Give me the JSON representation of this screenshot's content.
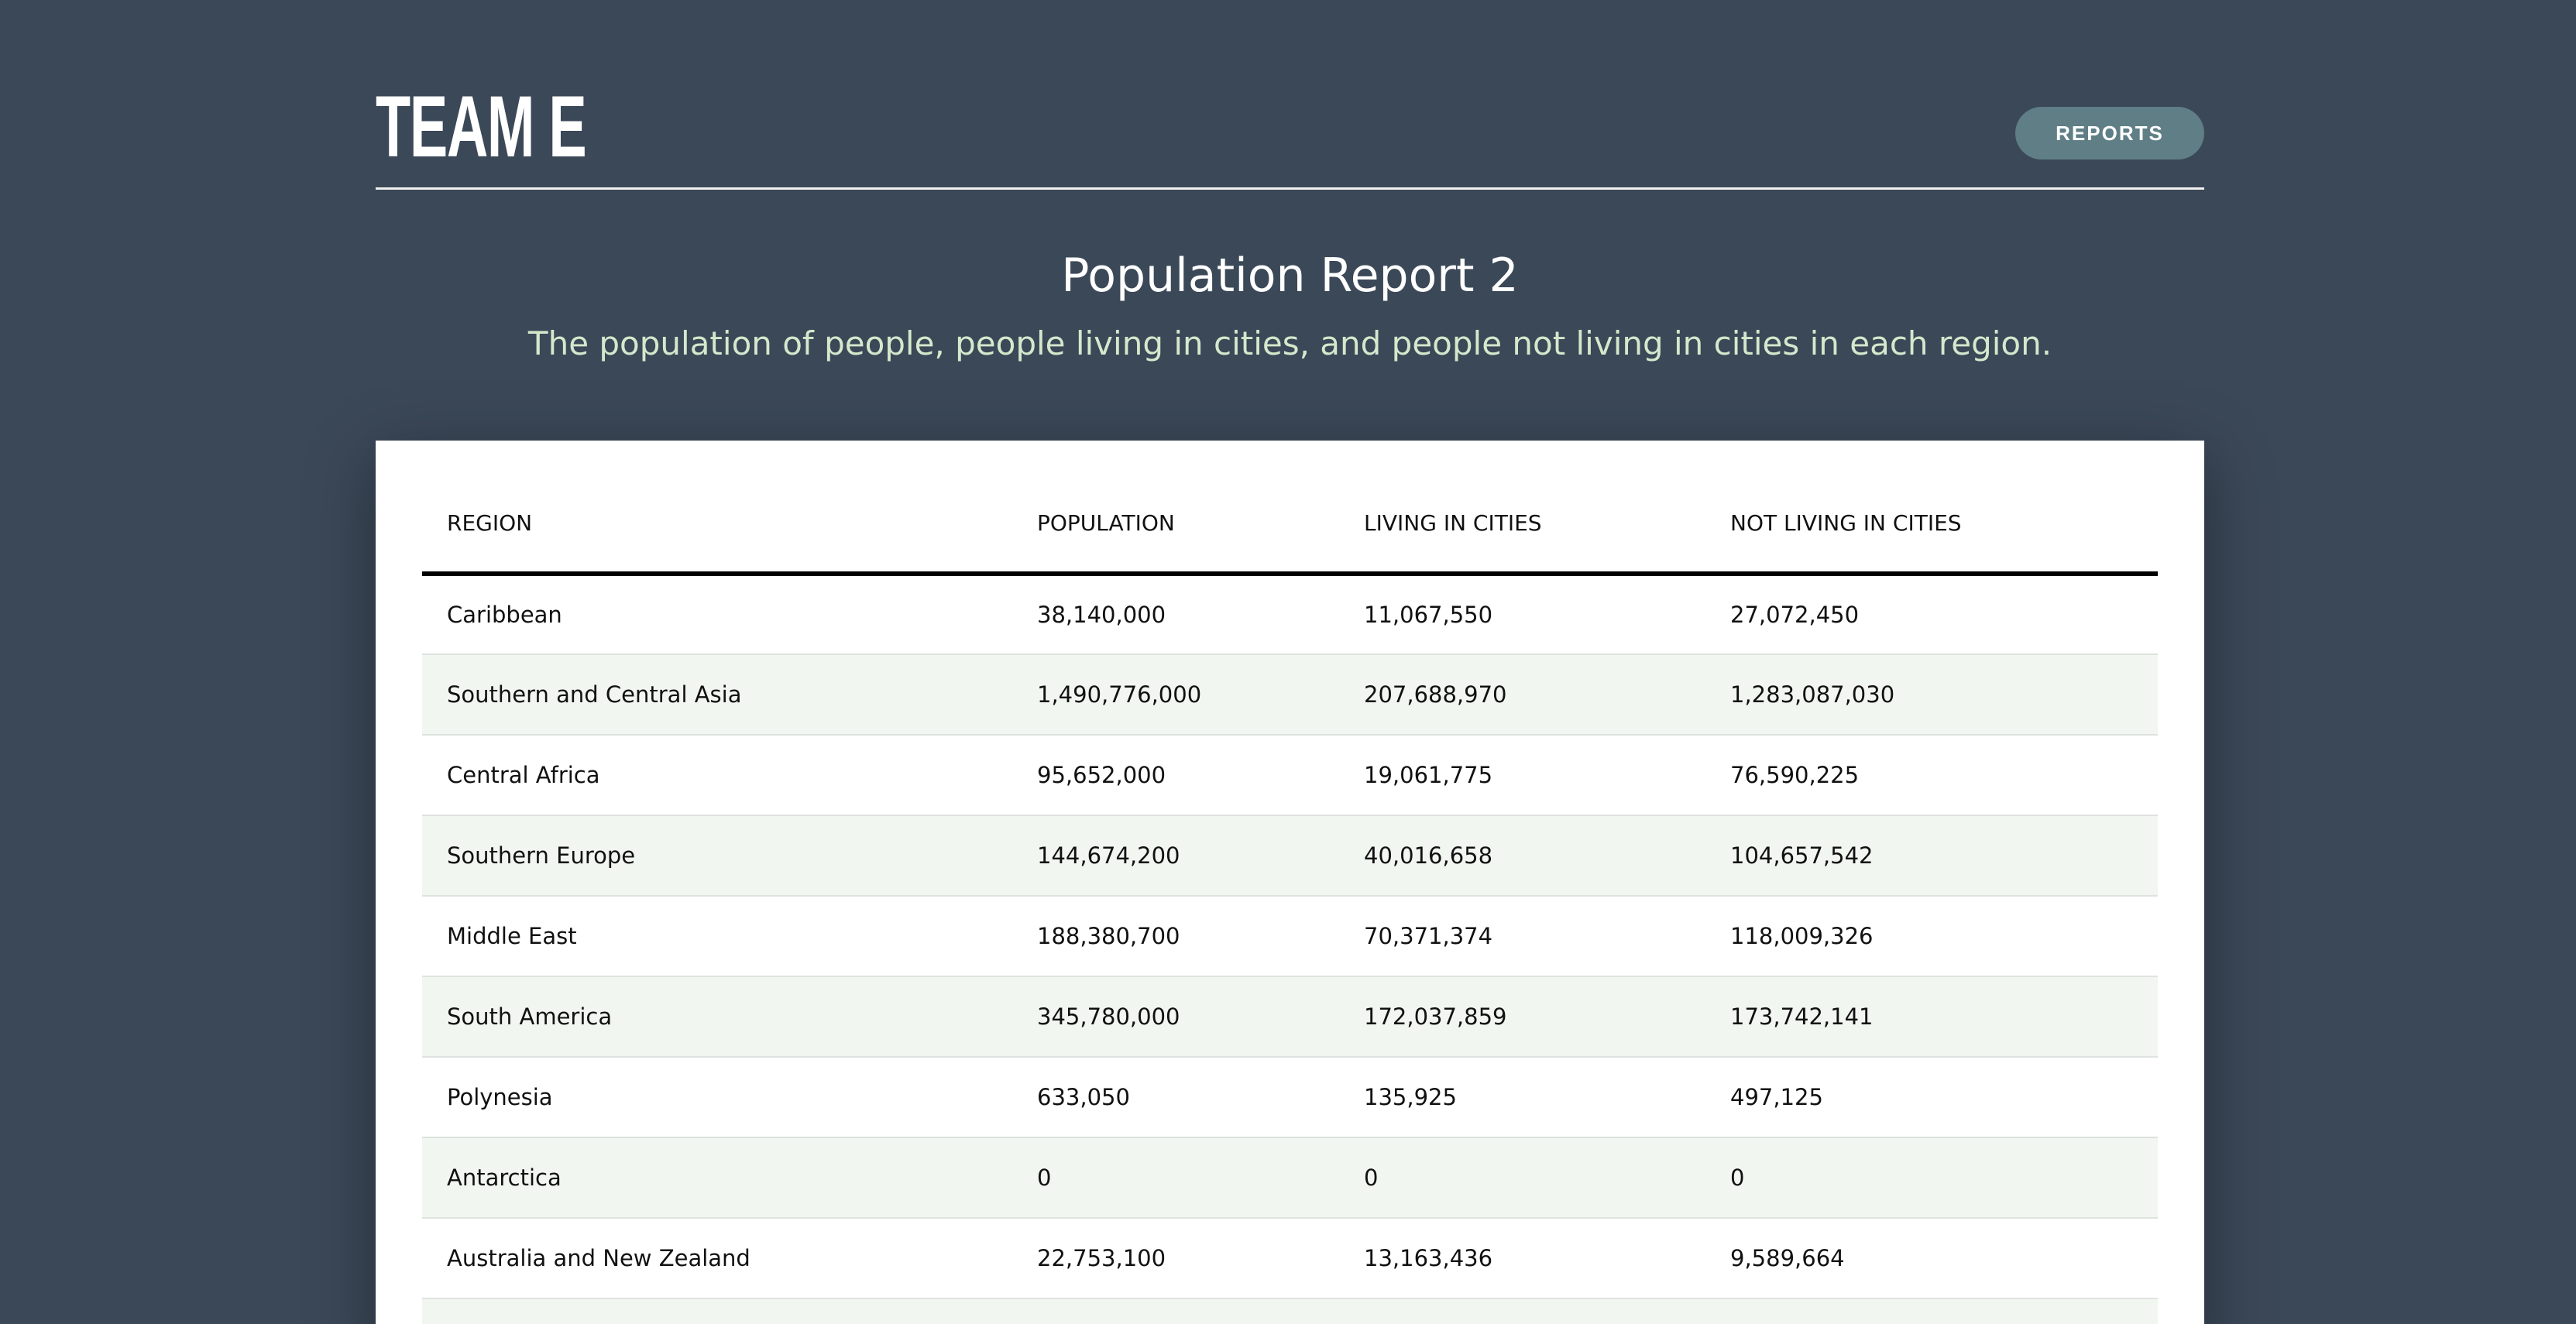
{
  "header": {
    "brand": "TEAM E",
    "reports_button": "REPORTS"
  },
  "report": {
    "title": "Population Report 2",
    "subtitle": "The population of people, people living in cities, and people not living in cities in each region."
  },
  "table": {
    "columns": [
      "REGION",
      "POPULATION",
      "LIVING IN CITIES",
      "NOT LIVING IN CITIES"
    ],
    "rows": [
      [
        "Caribbean",
        "38,140,000",
        "11,067,550",
        "27,072,450"
      ],
      [
        "Southern and Central Asia",
        "1,490,776,000",
        "207,688,970",
        "1,283,087,030"
      ],
      [
        "Central Africa",
        "95,652,000",
        "19,061,775",
        "76,590,225"
      ],
      [
        "Southern Europe",
        "144,674,200",
        "40,016,658",
        "104,657,542"
      ],
      [
        "Middle East",
        "188,380,700",
        "70,371,374",
        "118,009,326"
      ],
      [
        "South America",
        "345,780,000",
        "172,037,859",
        "173,742,141"
      ],
      [
        "Polynesia",
        "633,050",
        "135,925",
        "497,125"
      ],
      [
        "Antarctica",
        "0",
        "0",
        "0"
      ],
      [
        "Australia and New Zealand",
        "22,753,100",
        "13,163,436",
        "9,589,664"
      ]
    ]
  }
}
